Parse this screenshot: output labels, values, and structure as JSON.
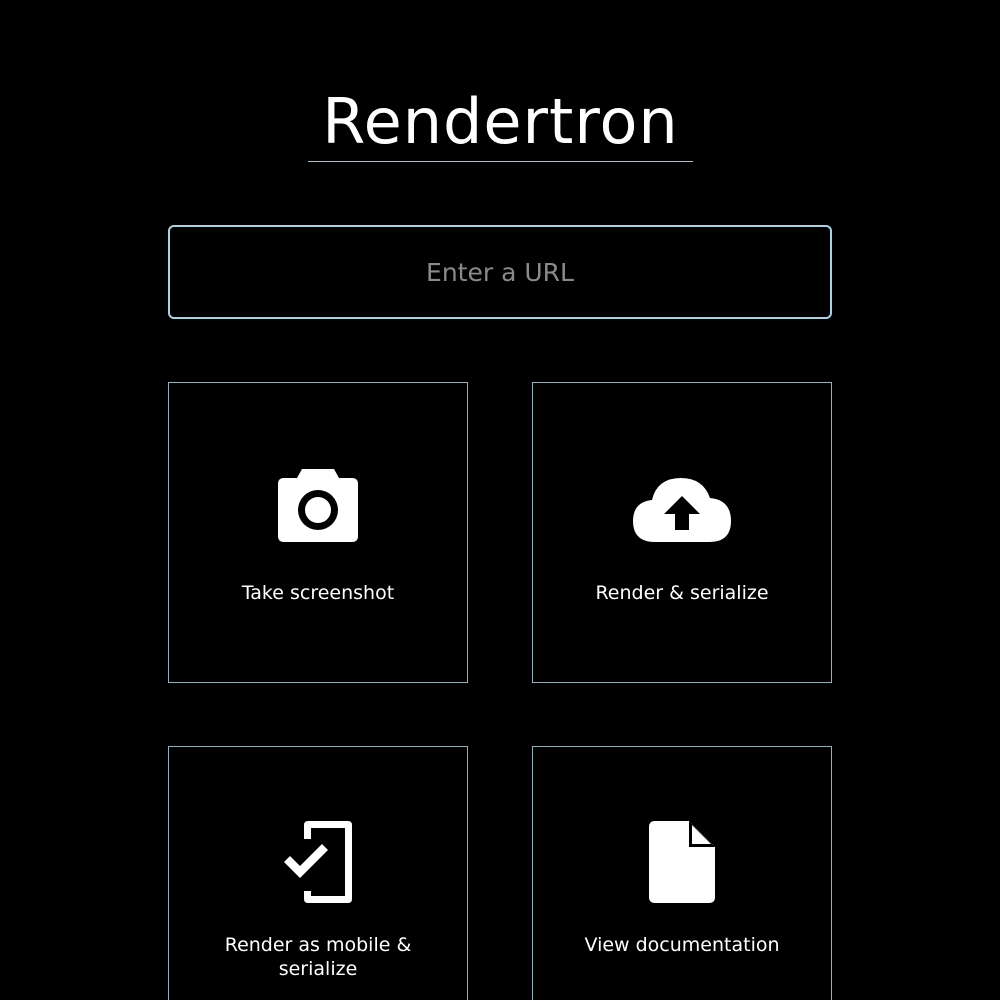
{
  "app": {
    "title": "Rendertron"
  },
  "url_input": {
    "placeholder": "Enter a URL",
    "value": ""
  },
  "actions": [
    {
      "label": "Take screenshot",
      "icon": "camera-icon"
    },
    {
      "label": "Render & serialize",
      "icon": "cloud-upload-icon"
    },
    {
      "label": "Render as mobile & serialize",
      "icon": "mobile-check-icon"
    },
    {
      "label": "View documentation",
      "icon": "document-icon"
    }
  ],
  "colors": {
    "background": "#000000",
    "text": "#ffffff",
    "accent_border": "#a7d4e4",
    "card_border": "#8fb3c1",
    "placeholder": "#8a8a8a"
  }
}
